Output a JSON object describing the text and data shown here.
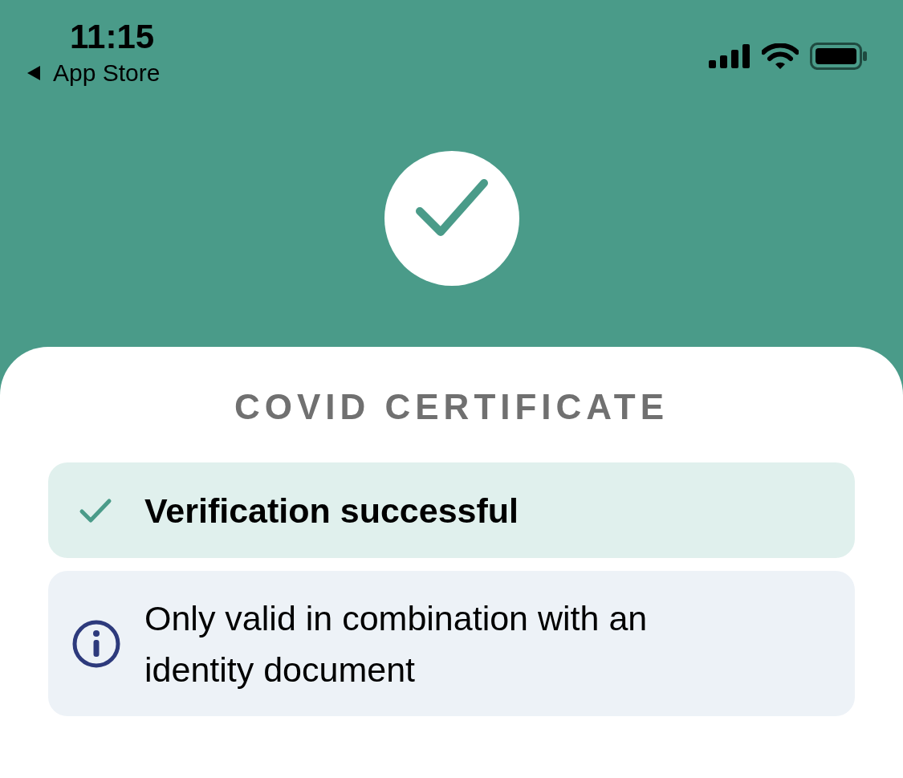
{
  "status_bar": {
    "time": "11:15",
    "back_link": "App Store"
  },
  "title": "COVID CERTIFICATE",
  "messages": [
    {
      "kind": "success",
      "text": "Verification successful"
    },
    {
      "kind": "info",
      "text": "Only valid in combination with an identity document"
    }
  ]
}
